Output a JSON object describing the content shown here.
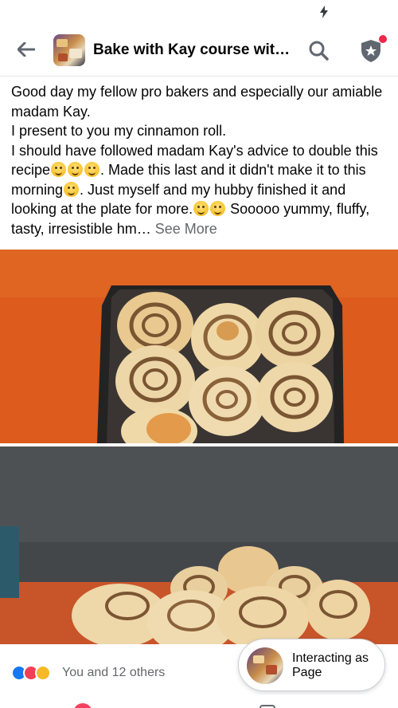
{
  "header": {
    "title": "Bake with Kay course wit…"
  },
  "post": {
    "lines": [
      "Good day my fellow pro bakers and especially our amiable madam Kay.",
      "I present to you my cinnamon roll."
    ],
    "para3_part1": "I should have followed madam Kay's advice to double this recipe",
    "para3_part2": ". Made this last and it didn't make it to this morning",
    "para3_part3": ". Just myself and my hubby finished it and looking at the plate for more.",
    "para3_part4": " Sooooo yummy, fluffy, tasty, irresistible hm… ",
    "see_more": "See More"
  },
  "reactions": {
    "summary": "You and 12 others"
  },
  "interacting_chip": {
    "label": "Interacting as Page"
  },
  "colors": {
    "accent": "#1877f2",
    "notification": "#f02849",
    "secondary_text": "#65676b"
  }
}
